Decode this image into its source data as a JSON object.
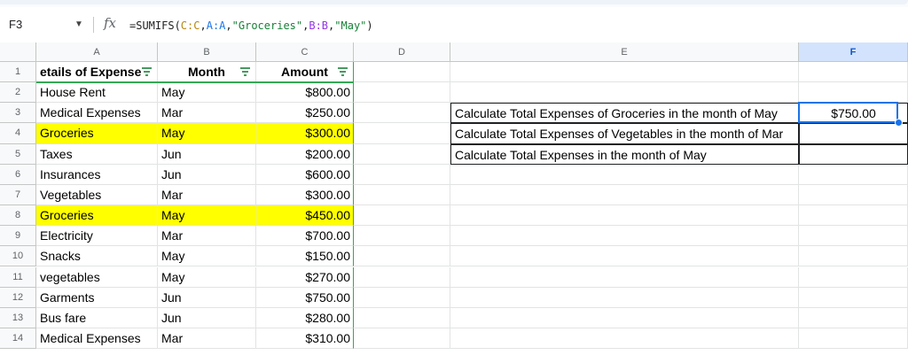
{
  "formula_bar": {
    "cell_ref": "F3",
    "formula_prefix": "=SUMIFS(",
    "arg1": "C:C",
    "comma1": ",",
    "arg2": "A:A",
    "comma2": ",",
    "arg3": "\"Groceries\"",
    "comma3": ",",
    "arg4": "B:B",
    "comma4": ",",
    "arg5": "\"May\"",
    "formula_suffix": ")"
  },
  "columns": [
    "A",
    "B",
    "C",
    "D",
    "E",
    "F"
  ],
  "rows": [
    "1",
    "2",
    "3",
    "4",
    "5",
    "6",
    "7",
    "8",
    "9",
    "10",
    "11",
    "12",
    "13",
    "14"
  ],
  "headers": {
    "details": "etails of Expense",
    "month": "Month",
    "amount": "Amount"
  },
  "table": [
    {
      "details": "House Rent",
      "month": "May",
      "amount": "$800.00"
    },
    {
      "details": "Medical Expenses",
      "month": "Mar",
      "amount": "$250.00"
    },
    {
      "details": "Groceries",
      "month": "May",
      "amount": "$300.00",
      "highlight": true
    },
    {
      "details": "Taxes",
      "month": "Jun",
      "amount": "$200.00"
    },
    {
      "details": "Insurances",
      "month": "Jun",
      "amount": "$600.00"
    },
    {
      "details": "Vegetables",
      "month": "Mar",
      "amount": "$300.00"
    },
    {
      "details": "Groceries",
      "month": "May",
      "amount": "$450.00",
      "highlight": true
    },
    {
      "details": "Electricity",
      "month": "Mar",
      "amount": "$700.00"
    },
    {
      "details": "Snacks",
      "month": "May",
      "amount": "$150.00"
    },
    {
      "details": "vegetables",
      "month": "May",
      "amount": "$270.00"
    },
    {
      "details": "Garments",
      "month": "Jun",
      "amount": "$750.00"
    },
    {
      "details": "Bus fare",
      "month": "Jun",
      "amount": "$280.00"
    },
    {
      "details": "Medical Expenses",
      "month": "Mar",
      "amount": "$310.00"
    }
  ],
  "questions": [
    {
      "text": "Calculate Total Expenses of Groceries in the month of May",
      "answer": "$750.00"
    },
    {
      "text": "Calculate Total Expenses of Vegetables in the month of Mar",
      "answer": ""
    },
    {
      "text": "Calculate Total Expenses  in the month of May",
      "answer": ""
    }
  ],
  "colors": {
    "highlight": "#ffff00",
    "selection": "#1a73e8",
    "table_border": "#34a853"
  }
}
